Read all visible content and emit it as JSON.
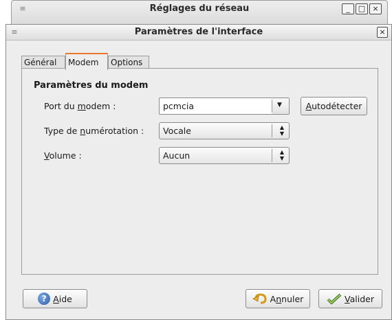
{
  "back_window": {
    "title": "Réglages du réseau",
    "buttons": [
      "_",
      "□",
      "×"
    ]
  },
  "dialog": {
    "title": "Paramètres de l'interface",
    "close_glyph": "×"
  },
  "tabs": [
    {
      "label": "Général",
      "active": false
    },
    {
      "label": "Modem",
      "active": true
    },
    {
      "label": "Options",
      "active": false
    }
  ],
  "section": {
    "title": "Paramètres du modem"
  },
  "fields": {
    "port": {
      "label_before": "Port du ",
      "label_mnemonic": "m",
      "label_after": "odem :",
      "value": "pcmcia"
    },
    "dial_type": {
      "label_before": "Type de ",
      "label_mnemonic": "n",
      "label_after": "umérotation :",
      "value": "Vocale"
    },
    "volume": {
      "label_before": "",
      "label_mnemonic": "V",
      "label_after": "olume :",
      "value": "Aucun"
    }
  },
  "buttons": {
    "autodetect": {
      "mnemonic": "A",
      "rest": "utodétecter"
    },
    "help": {
      "mnemonic": "A",
      "rest": "ide"
    },
    "cancel": {
      "before": "A",
      "mnemonic": "n",
      "rest": "nuler"
    },
    "validate": {
      "mnemonic": "V",
      "rest": "alider"
    }
  },
  "icons": {
    "window_menu": "≡",
    "dropdown_arrow": "▼",
    "updown": "▲▼",
    "help": "?"
  }
}
